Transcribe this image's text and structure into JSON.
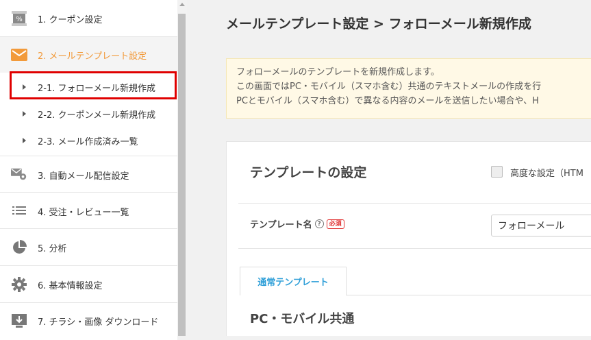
{
  "sidebar": {
    "items": [
      {
        "label": "1. クーポン設定",
        "icon": "coupon-icon"
      },
      {
        "label": "2. メールテンプレート設定",
        "icon": "mail-icon"
      },
      {
        "label": "3. 自動メール配信設定",
        "icon": "mail-gear-icon"
      },
      {
        "label": "4. 受注・レビュー一覧",
        "icon": "list-icon"
      },
      {
        "label": "5. 分析",
        "icon": "pie-chart-icon"
      },
      {
        "label": "6. 基本情報設定",
        "icon": "gear-icon"
      },
      {
        "label": "7. チラシ・画像 ダウンロード",
        "icon": "download-icon"
      }
    ],
    "sub_items": [
      {
        "label": "2-1. フォローメール新規作成"
      },
      {
        "label": "2-2. クーポンメール新規作成"
      },
      {
        "label": "2-3. メール作成済み一覧"
      }
    ],
    "active_color": "#f29a3a"
  },
  "main": {
    "title": "メールテンプレート設定 > フォローメール新規作成",
    "notice": [
      "フォローメールのテンプレートを新規作成します。",
      "この画面ではPC・モバイル（スマホ含む）共通のテキストメールの作成を行",
      "PCとモバイル（スマホ含む）で異なる内容のメールを送信したい場合や、H"
    ],
    "card": {
      "title": "テンプレートの設定",
      "advanced_label": "高度な設定（HTM",
      "field_label": "テンプレート名",
      "help": "?",
      "required": "必須",
      "field_value": "フォローメール",
      "tab_label": "通常テンプレート",
      "section_title": "PC・モバイル共通"
    }
  }
}
